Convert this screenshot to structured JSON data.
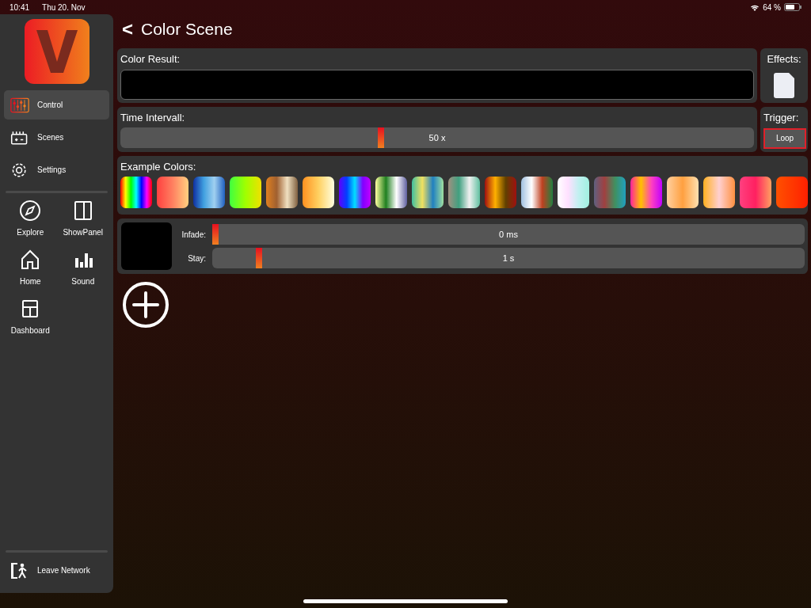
{
  "status_bar": {
    "time": "10:41",
    "date": "Thu 20. Nov",
    "battery": "64 %"
  },
  "sidebar": {
    "items": [
      {
        "label": "Control",
        "selected": true
      },
      {
        "label": "Scenes",
        "selected": false
      },
      {
        "label": "Settings",
        "selected": false
      }
    ],
    "grid": [
      {
        "label": "Explore"
      },
      {
        "label": "ShowPanel"
      },
      {
        "label": "Home"
      },
      {
        "label": "Sound"
      },
      {
        "label": "Dashboard"
      }
    ],
    "footer": {
      "label": "Leave Network"
    }
  },
  "header": {
    "back": "<",
    "title": "Color Scene"
  },
  "color_result": {
    "label": "Color Result:"
  },
  "effects": {
    "label": "Effects:"
  },
  "time_interval": {
    "label": "Time Intervall:",
    "level": 0.41,
    "reading": "50 x"
  },
  "trigger": {
    "label": "Trigger:",
    "button": "Loop"
  },
  "example_colors": {
    "label": "Example Colors:"
  },
  "step": {
    "rows": [
      {
        "label": "Infade:",
        "level": 0.0,
        "reading": "0 ms"
      },
      {
        "label": "Stay:",
        "level": 0.074,
        "reading": "1 s"
      }
    ]
  }
}
